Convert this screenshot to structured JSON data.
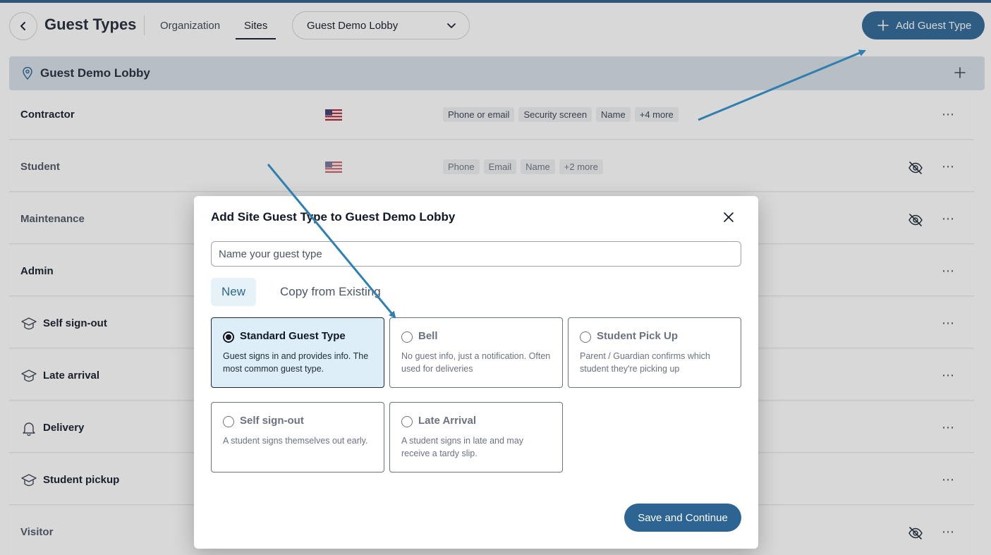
{
  "header": {
    "title": "Guest Types",
    "tabs": [
      {
        "label": "Organization",
        "active": false
      },
      {
        "label": "Sites",
        "active": true
      }
    ],
    "site_select": "Guest Demo Lobby",
    "add_button": "Add Guest Type"
  },
  "group": {
    "title": "Guest Demo Lobby"
  },
  "rows": [
    {
      "name": "Contractor",
      "flag": "us-flag",
      "tags": [
        "Phone or email",
        "Security screen",
        "Name",
        "+4 more"
      ],
      "hidden": false
    },
    {
      "name": "Student",
      "flag": "us-flag",
      "tags": [
        "Phone",
        "Email",
        "Name",
        "+2 more"
      ],
      "hidden": true
    },
    {
      "name": "Maintenance",
      "hidden": true
    },
    {
      "name": "Admin",
      "hidden": false
    },
    {
      "name": "Self sign-out",
      "icon": "graduation-cap-icon",
      "hidden": false
    },
    {
      "name": "Late arrival",
      "icon": "graduation-cap-icon",
      "hidden": false
    },
    {
      "name": "Delivery",
      "icon": "bell-icon",
      "hidden": false
    },
    {
      "name": "Student pickup",
      "icon": "graduation-cap-icon",
      "hidden": false
    },
    {
      "name": "Visitor",
      "hidden": true
    }
  ],
  "modal": {
    "title": "Add Site Guest Type to Guest Demo Lobby",
    "name_placeholder": "Name your guest type",
    "tabs": [
      {
        "label": "New",
        "active": true
      },
      {
        "label": "Copy from Existing",
        "active": false
      }
    ],
    "options": [
      {
        "title": "Standard Guest Type",
        "desc": "Guest signs in and provides info. The most common guest type.",
        "selected": true
      },
      {
        "title": "Bell",
        "desc": "No guest info, just a notification. Often used for deliveries",
        "selected": false
      },
      {
        "title": "Student Pick Up",
        "desc": "Parent / Guardian confirms which student they're picking up",
        "selected": false
      },
      {
        "title": "Self sign-out",
        "desc": "A student signs themselves out early.",
        "selected": false
      },
      {
        "title": "Late Arrival",
        "desc": "A student signs in late and may receive a tardy slip.",
        "selected": false
      }
    ],
    "save_button": "Save and Continue"
  },
  "colors": {
    "primary": "#2c6594",
    "arrow": "#2f7fb0",
    "group_bar": "#d6dfe7",
    "selected_card": "#ddeef8"
  }
}
